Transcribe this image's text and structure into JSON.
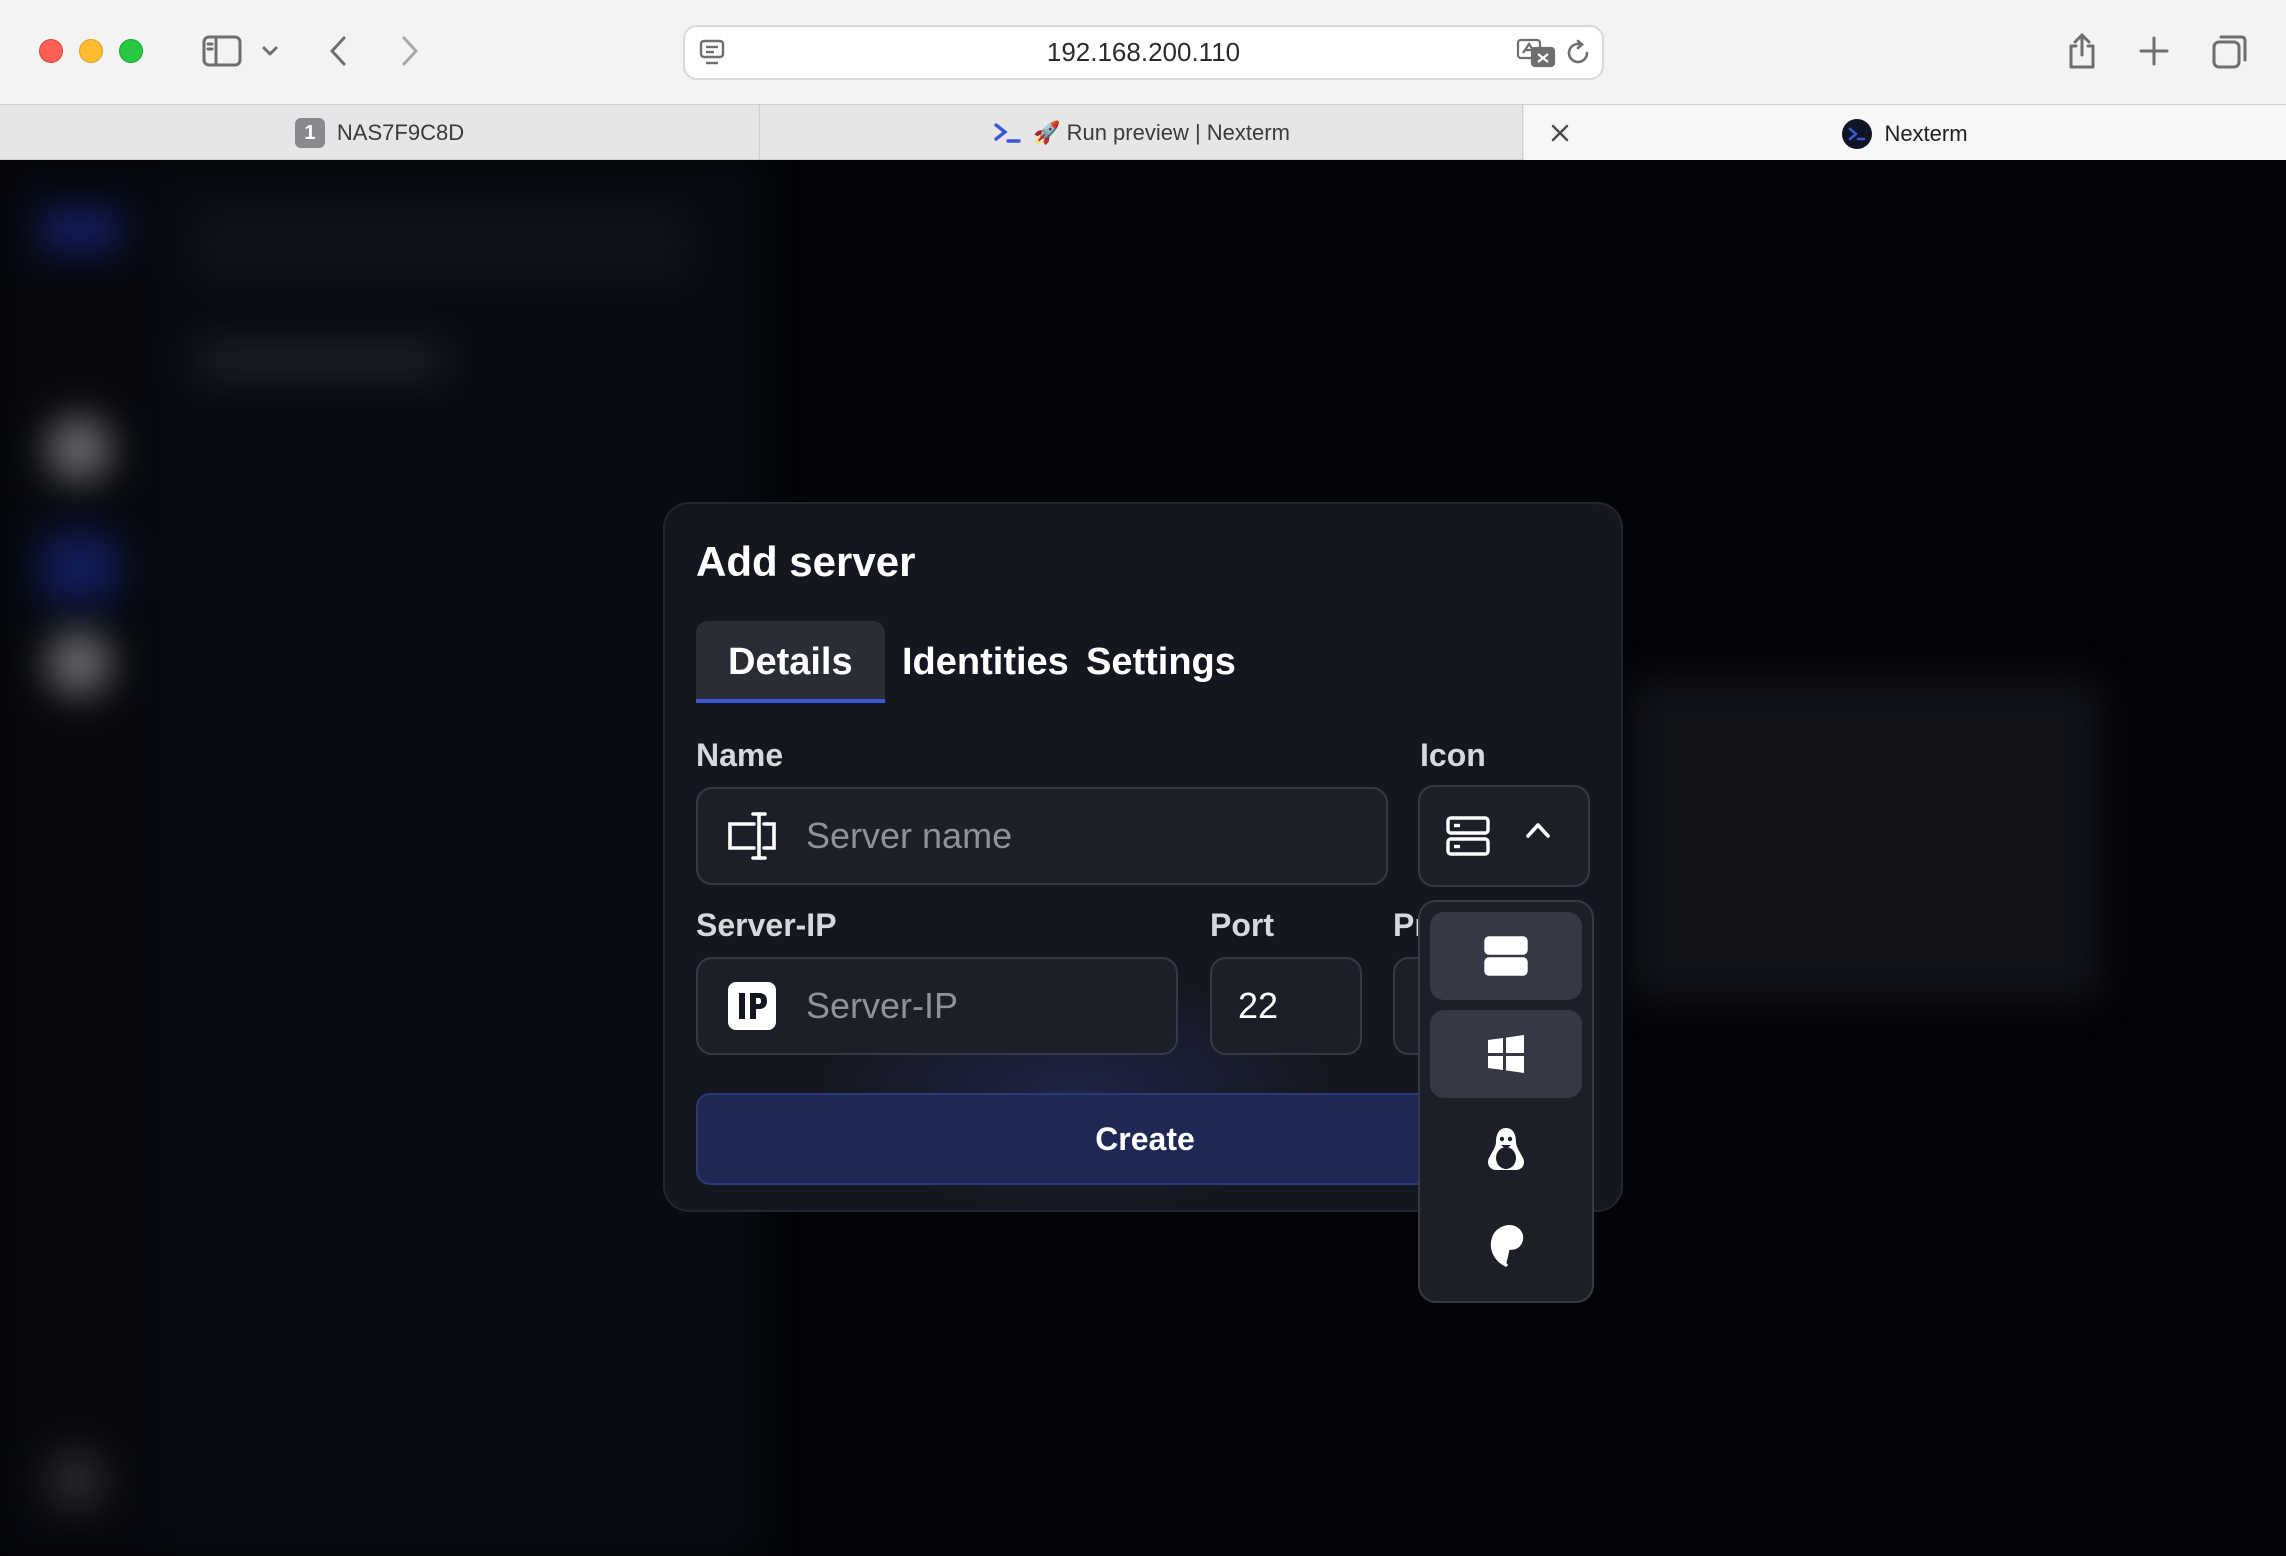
{
  "browser": {
    "url": "192.168.200.110",
    "tabs": [
      {
        "label": "NAS7F9C8D",
        "badge": "1"
      },
      {
        "label": "🚀 Run preview | Nexterm"
      },
      {
        "label": "Nexterm"
      }
    ]
  },
  "modal": {
    "title": "Add server",
    "tabs": [
      "Details",
      "Identities",
      "Settings"
    ],
    "active_tab": "Details",
    "name": {
      "label": "Name",
      "placeholder": "Server name"
    },
    "icon": {
      "label": "Icon",
      "selected": "server-icon",
      "options": [
        "server-icon",
        "windows-icon",
        "linux-icon",
        "debian-icon"
      ]
    },
    "server_ip": {
      "label": "Server-IP",
      "placeholder": "Server-IP"
    },
    "port": {
      "label": "Port",
      "value": "22"
    },
    "protocol": {
      "label": "Pr"
    },
    "create_label": "Create"
  },
  "colors": {
    "accent": "#3b57d6",
    "create_bg": "#1f2854",
    "modal_bg": "#14171f"
  }
}
